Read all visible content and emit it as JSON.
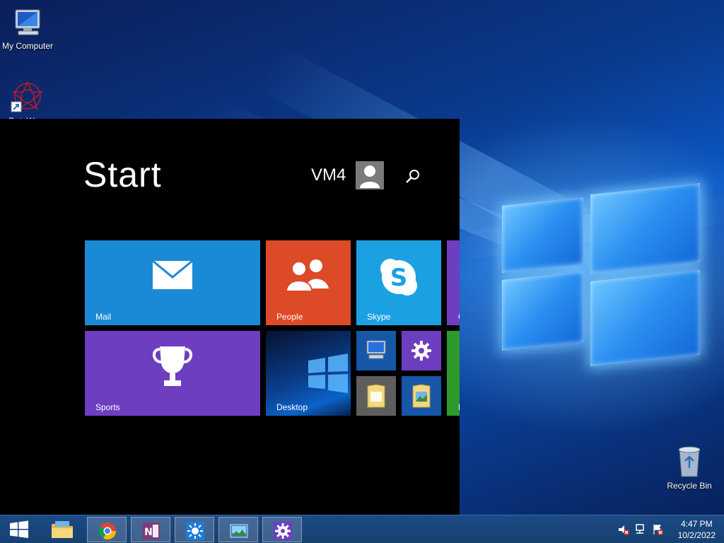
{
  "desktop": {
    "icons": [
      {
        "label": "My Computer"
      },
      {
        "label": "DataWare"
      },
      {
        "label": "Recycle Bin"
      }
    ]
  },
  "start_menu": {
    "title": "Start",
    "user_name": "VM4",
    "tiles": {
      "mail": {
        "label": "Mail",
        "color": "#1b8ad6"
      },
      "people": {
        "label": "People",
        "color": "#dc4a28"
      },
      "skype": {
        "label": "Skype",
        "color": "#1ba1e2"
      },
      "sports": {
        "label": "Sports",
        "color": "#6e3ec1"
      },
      "desktop": {
        "label": "Desktop"
      },
      "partial_purple": {
        "label": "C",
        "color": "#6e3ec1"
      },
      "partial_green": {
        "label": "M",
        "color": "#2d9a2b"
      }
    }
  },
  "taskbar": {
    "items": [
      "start-icon",
      "file-explorer-icon",
      "chrome-icon",
      "onenote-icon",
      "weather-icon",
      "photos-icon",
      "settings-icon"
    ],
    "clock_time": "4:47 PM",
    "clock_date": "10/2/2022"
  }
}
